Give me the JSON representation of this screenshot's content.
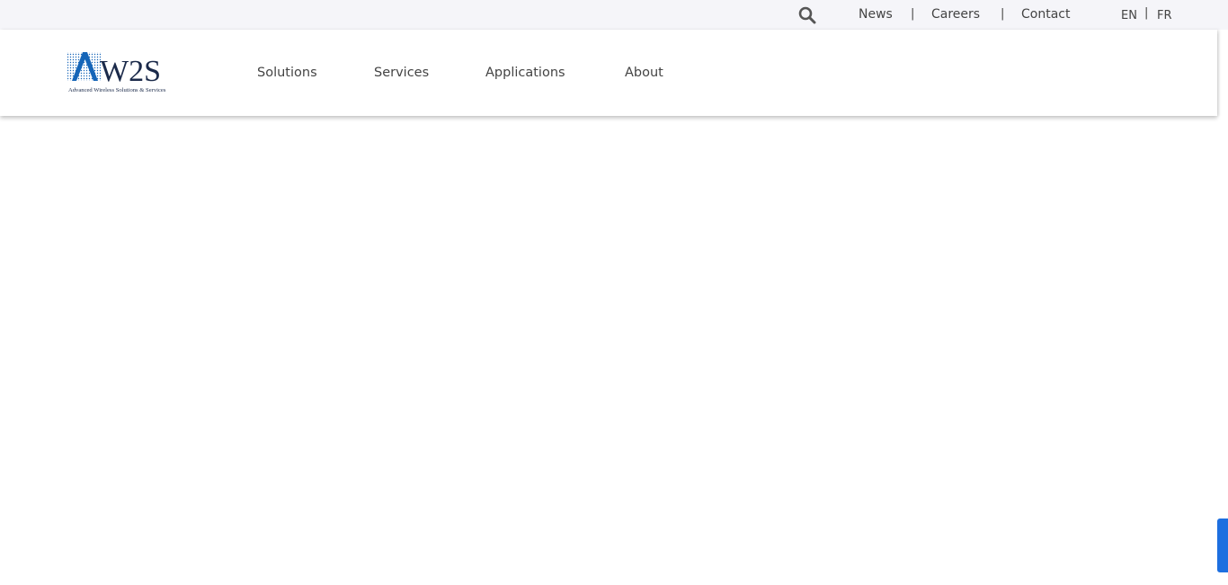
{
  "topbar": {
    "search_icon": "search-icon",
    "links": [
      {
        "label": "News"
      },
      {
        "label": "Careers"
      },
      {
        "label": "Contact"
      }
    ],
    "separator": "|",
    "languages": [
      {
        "code": "EN"
      },
      {
        "code": "FR"
      }
    ]
  },
  "header": {
    "logo": {
      "mark": "ΛW2S",
      "tagline": "Advanced Wireless Solutions & Services"
    },
    "nav": [
      {
        "label": "Solutions"
      },
      {
        "label": "Services"
      },
      {
        "label": "Applications"
      },
      {
        "label": "About"
      }
    ]
  },
  "colors": {
    "logo_blue": "#1565b8",
    "logo_dark": "#1b2a4a",
    "side_tab": "#1d6fe0",
    "topbar_bg": "#f5f5f9",
    "text": "#444444"
  }
}
